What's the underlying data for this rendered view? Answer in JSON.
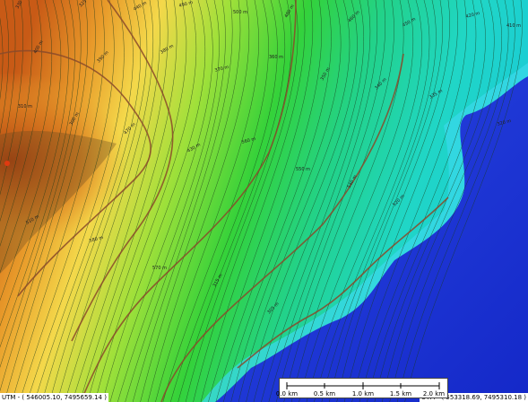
{
  "map": {
    "utm_left": "UTM - ( 546005.10, 7495659.14 )",
    "utm_right": "UTM - ( 553318.69, 7495310.18 )",
    "scale_labels": [
      "0.0 km",
      "0.5 km",
      "1.0 km",
      "1.5 km",
      "2.0 km"
    ],
    "contour_unit": "m",
    "contour_labels": [
      "330 m",
      "325 m",
      "440 m",
      "490 m",
      "500 m",
      "480 m",
      "460 m",
      "450 m",
      "420 m",
      "410 m",
      "400 m",
      "390 m",
      "380 m",
      "370 m",
      "360 m",
      "350 m",
      "340 m",
      "335 m",
      "320 m",
      "310 m",
      "300 m",
      "470 m",
      "430 m",
      "560 m",
      "550 m",
      "540 m",
      "520 m",
      "510 m",
      "580 m",
      "570 m",
      "315 m",
      "305 m"
    ],
    "colors": {
      "high": "#d8621a",
      "mid_high": "#f0d24a",
      "mid": "#3cd23c",
      "low": "#1ed2c8",
      "water": "#1e32dc",
      "index_contour": "#8a4a2a"
    }
  }
}
